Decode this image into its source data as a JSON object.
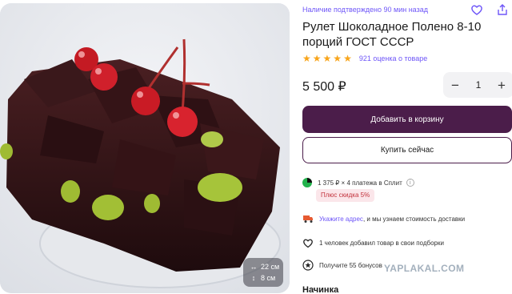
{
  "product": {
    "availability": "Наличие подтверждено 90 мин назад",
    "title": "Рулет Шоколадное Полено 8-10 порций ГОСТ СССР",
    "rating_stars": 5,
    "reviews": "921 оценка о товаре",
    "price": "5 500 ₽",
    "quantity": "1",
    "qty_minus": "−",
    "qty_plus": "+"
  },
  "image": {
    "dimensions": {
      "length": "22 см",
      "height": "8 см"
    }
  },
  "buttons": {
    "add_to_cart": "Добавить в корзину",
    "buy_now": "Купить сейчас"
  },
  "split": {
    "text": "1 375 ₽ × 4 платежа в Сплит",
    "help": "i",
    "discount": "Плюс скидка 5%"
  },
  "delivery": {
    "link": "Укажите адрес",
    "text": ", и мы узнаем стоимость доставки"
  },
  "added": {
    "text": "1 человек добавил товар в свои подборки"
  },
  "bonus": {
    "text": "Получите 55 бонусов"
  },
  "section": {
    "title": "Начинка"
  },
  "watermark": "YAPLAKAL.COM",
  "colors": {
    "accent": "#6e56f8",
    "primary_button": "#4b1d4a",
    "star": "#f8a51b",
    "discount_bg": "#fbe6ea",
    "discount_text": "#c2323c"
  },
  "icons": [
    "heart-icon",
    "share-icon",
    "split-logo-icon",
    "truck-icon",
    "heart-outline-icon",
    "bonus-star-icon",
    "resize-horizontal-icon",
    "resize-vertical-icon"
  ]
}
